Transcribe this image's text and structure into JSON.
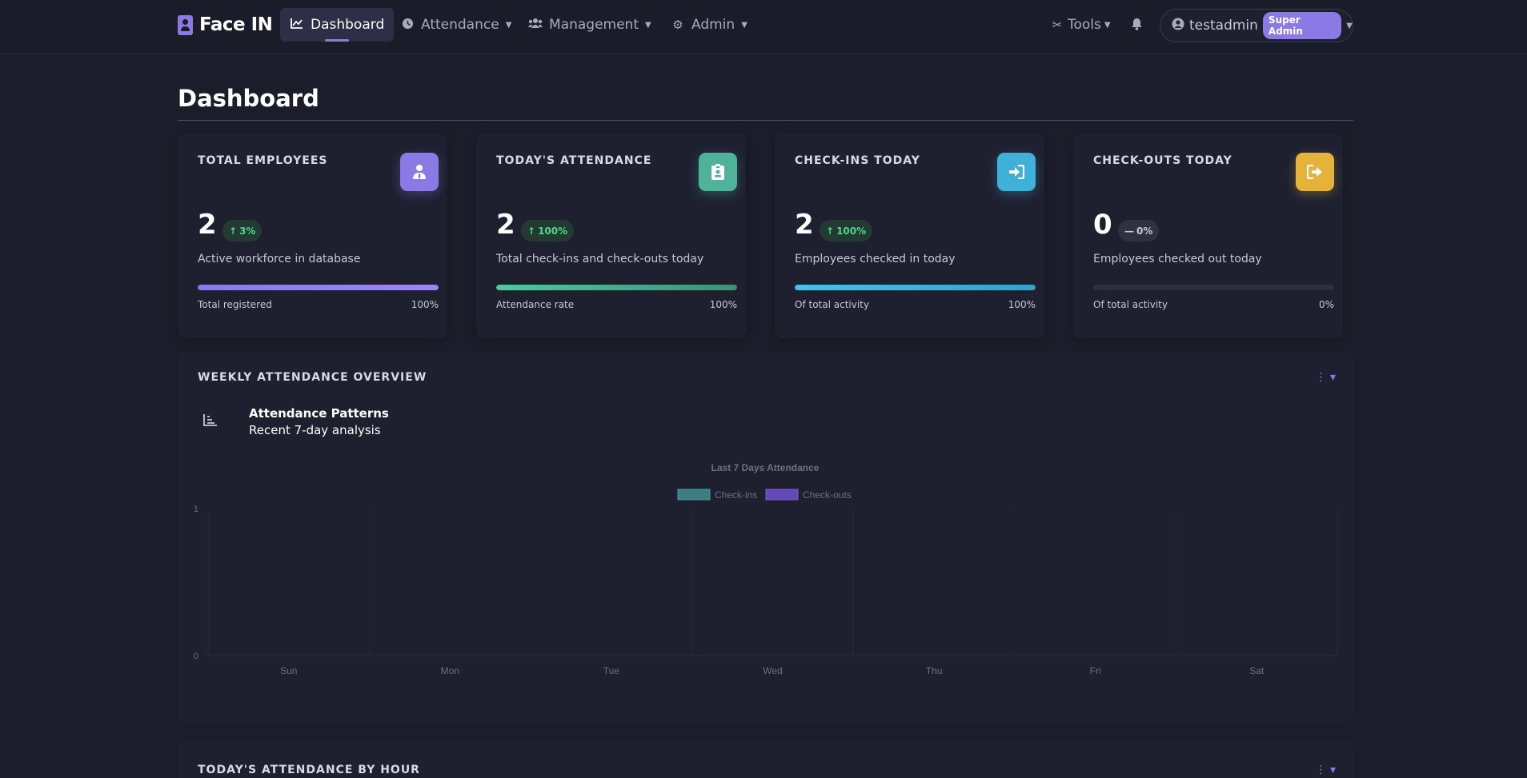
{
  "brand": {
    "name": "Face IN"
  },
  "nav": {
    "dashboard": "Dashboard",
    "attendance": "Attendance",
    "management": "Management",
    "admin": "Admin",
    "tools": "Tools"
  },
  "user": {
    "name": "testadmin",
    "role": "Super Admin"
  },
  "page": {
    "title": "Dashboard"
  },
  "cards": [
    {
      "label": "TOTAL EMPLOYEES",
      "value": "2",
      "trend": "3%",
      "trend_dir": "up",
      "desc": "Active workforce in database",
      "foot_left": "Total registered",
      "foot_right": "100%",
      "progress": 100,
      "icon": "user-tie-icon",
      "color": "#8b7ae6"
    },
    {
      "label": "TODAY'S ATTENDANCE",
      "value": "2",
      "trend": "100%",
      "trend_dir": "up",
      "desc": "Total check-ins and check-outs today",
      "foot_left": "Attendance rate",
      "foot_right": "100%",
      "progress": 100,
      "icon": "id-badge-icon",
      "color": "#4fb39c"
    },
    {
      "label": "CHECK-INS TODAY",
      "value": "2",
      "trend": "100%",
      "trend_dir": "up",
      "desc": "Employees checked in today",
      "foot_left": "Of total activity",
      "foot_right": "100%",
      "progress": 100,
      "icon": "sign-in-icon",
      "color": "#3fb0d8"
    },
    {
      "label": "CHECK-OUTS TODAY",
      "value": "0",
      "trend": "0%",
      "trend_dir": "neutral",
      "desc": "Employees checked out today",
      "foot_left": "Of total activity",
      "foot_right": "0%",
      "progress": 0,
      "icon": "sign-out-icon",
      "color": "#e5b33a"
    }
  ],
  "weekly": {
    "panel_title": "WEEKLY ATTENDANCE OVERVIEW",
    "patterns_title": "Attendance Patterns",
    "patterns_sub": "Recent 7-day analysis"
  },
  "hourly": {
    "panel_title": "TODAY'S ATTENDANCE BY HOUR"
  },
  "chart_data": {
    "type": "bar",
    "title": "Last 7 Days Attendance",
    "categories": [
      "Sun",
      "Mon",
      "Tue",
      "Wed",
      "Thu",
      "Fri",
      "Sat"
    ],
    "series": [
      {
        "name": "Check-ins",
        "values": [
          0,
          0,
          0,
          0,
          0,
          0,
          0
        ],
        "color": "#3d7d82"
      },
      {
        "name": "Check-outs",
        "values": [
          0,
          0,
          0,
          0,
          0,
          0,
          0
        ],
        "color": "#6548b8"
      }
    ],
    "ylim": [
      0,
      1
    ],
    "yticks": [
      "0",
      "1"
    ],
    "grid": true,
    "legend": "top"
  }
}
